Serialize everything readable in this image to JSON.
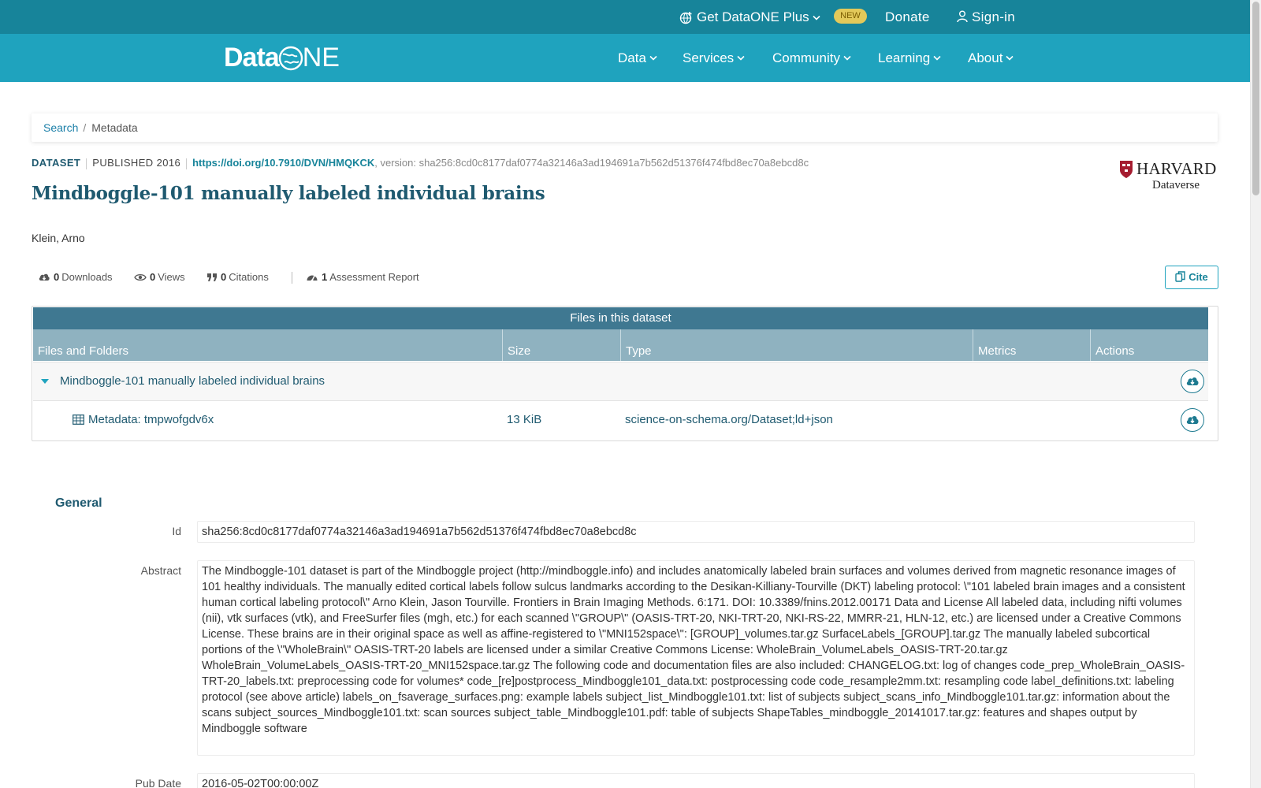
{
  "utility_bar": {
    "plus_label": "Get DataONE Plus",
    "new_badge": "NEW",
    "donate_label": "Donate",
    "signin_label": "Sign-in"
  },
  "nav": {
    "logo_text_left": "Data",
    "logo_text_right": "NE",
    "items": [
      {
        "label": "Data"
      },
      {
        "label": "Services"
      },
      {
        "label": "Community"
      },
      {
        "label": "Learning"
      },
      {
        "label": "About"
      }
    ]
  },
  "breadcrumb": {
    "search": "Search",
    "separator": "/",
    "current": "Metadata"
  },
  "dataset": {
    "type": "DATASET",
    "published": "PUBLISHED 2016",
    "doi": "https://doi.org/10.7910/DVN/HMQKCK",
    "version": ", version: sha256:8cd0c8177daf0774a32146a3ad194691a7b562d51376f474fbd8ec70a8ebcd8c",
    "title": "Mindboggle-101 manually labeled individual brains",
    "author": "Klein, Arno",
    "repository_name": "HARVARD",
    "repository_sub": "Dataverse"
  },
  "metrics": {
    "downloads_count": "0",
    "downloads_label": "Downloads",
    "views_count": "0",
    "views_label": "Views",
    "citations_count": "0",
    "citations_label": "Citations",
    "assessment_count": "1",
    "assessment_label": "Assessment Report",
    "cite_label": "Cite"
  },
  "files": {
    "caption": "Files in this dataset",
    "columns": [
      "Files and Folders",
      "Size",
      "Type",
      "Metrics",
      "Actions"
    ],
    "folder": {
      "name": "Mindboggle-101 manually labeled individual brains"
    },
    "rows": [
      {
        "name": "Metadata: tmpwofgdv6x",
        "size": "13 KiB",
        "type": "science-on-schema.org/Dataset;ld+json"
      }
    ]
  },
  "general": {
    "heading": "General",
    "id_label": "Id",
    "id_value": "sha256:8cd0c8177daf0774a32146a3ad194691a7b562d51376f474fbd8ec70a8ebcd8c",
    "abstract_label": "Abstract",
    "abstract_value": "The Mindboggle-101 dataset is part of the Mindboggle project (http://mindboggle.info) and includes anatomically labeled brain surfaces and volumes derived from magnetic resonance images of 101 healthy individuals. The manually edited cortical labels follow sulcus landmarks according to the Desikan-Killiany-Tourville (DKT) labeling protocol: \\\"101 labeled brain images and a consistent human cortical labeling protocol\\\" Arno Klein, Jason Tourville. Frontiers in Brain Imaging Methods. 6:171. DOI: 10.3389/fnins.2012.00171 Data and License All labeled data, including nifti volumes (nii), vtk surfaces (vtk), and FreeSurfer files (mgh, etc.) for each scanned \\\"GROUP\\\" (OASIS-TRT-20, NKI-TRT-20, NKI-RS-22, MMRR-21, HLN-12, etc.) are licensed under a Creative Commons License. These brains are in their original space as well as affine-registered to \\\"MNI152space\\\": [GROUP]_volumes.tar.gz SurfaceLabels_[GROUP].tar.gz The manually labeled subcortical portions of the \\\"WholeBrain\\\" OASIS-TRT-20 labels are licensed under a similar Creative Commons License: WholeBrain_VolumeLabels_OASIS-TRT-20.tar.gz WholeBrain_VolumeLabels_OASIS-TRT-20_MNI152space.tar.gz The following code and documentation files are also included: CHANGELOG.txt: log of changes code_prep_WholeBrain_OASIS-TRT-20_labels.txt: preprocessing code for volumes* code_[re]postprocess_Mindboggle101_data.txt: postprocessing code code_resample2mm.txt: resampling code label_definitions.txt: labeling protocol (see above article) labels_on_fsaverage_surfaces.png: example labels subject_list_Mindboggle101.txt: list of subjects subject_scans_info_Mindboggle101.tar.gz: information about the scans subject_sources_Mindboggle101.txt: scan sources subject_table_Mindboggle101.pdf: table of subjects ShapeTables_mindboggle_20141017.tar.gz: features and shapes output by Mindboggle software",
    "pubdate_label": "Pub Date",
    "pubdate_value": "2016-05-02T00:00:00Z"
  },
  "colors": {
    "utility_bar": "#17849a",
    "nav_bar": "#1fa3be",
    "title": "#1f5a70",
    "files_caption": "#3f7891",
    "files_header": "#8fb2c0",
    "new_badge": "#e3c95a"
  }
}
